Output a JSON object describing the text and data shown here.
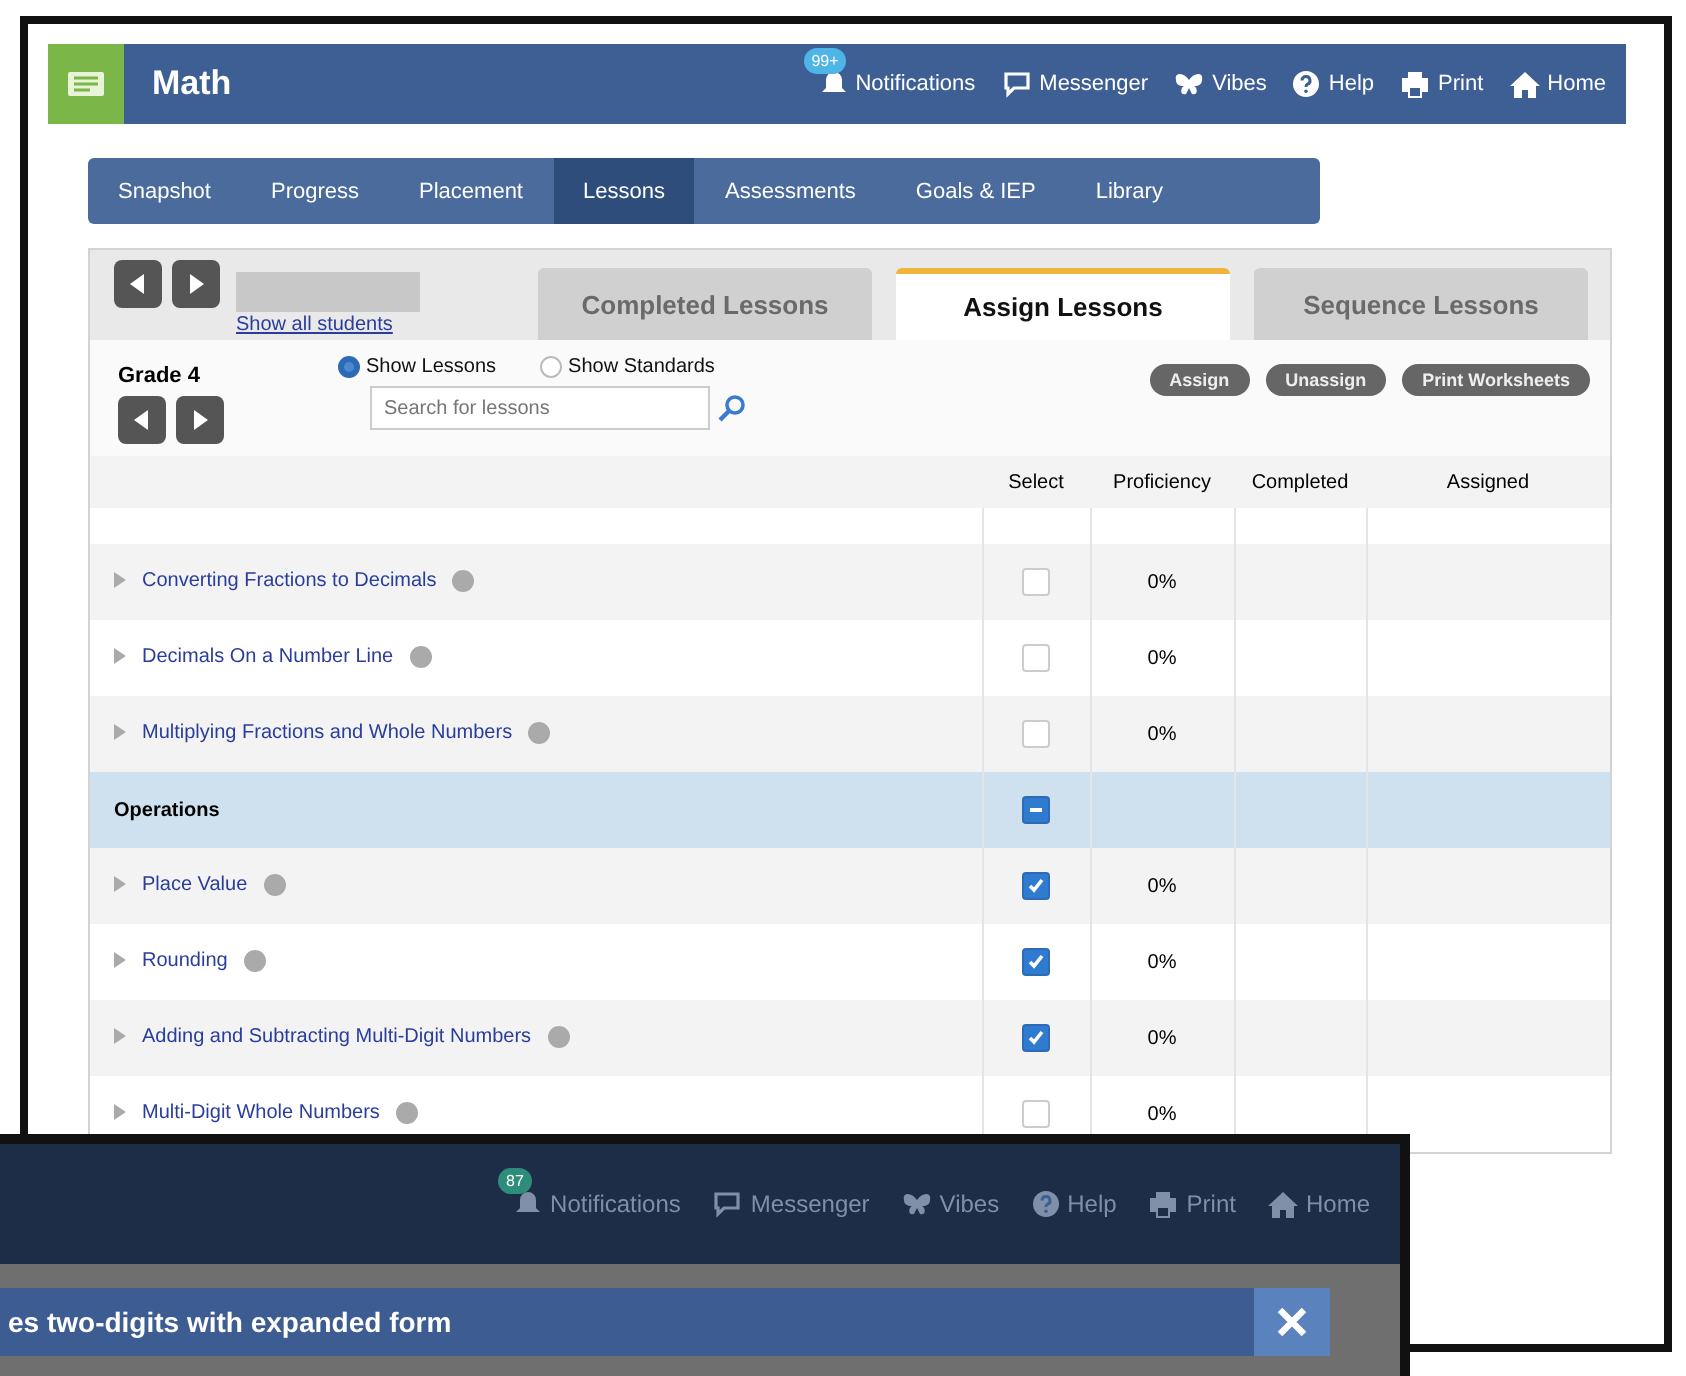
{
  "main_window": {
    "app_title": "Math",
    "header_links": [
      {
        "label": "Notifications",
        "badge": "99+"
      },
      {
        "label": "Messenger"
      },
      {
        "label": "Vibes"
      },
      {
        "label": "Help"
      },
      {
        "label": "Print"
      },
      {
        "label": "Home"
      }
    ],
    "nav_tabs": [
      {
        "label": "Snapshot",
        "selected": false
      },
      {
        "label": "Progress",
        "selected": false
      },
      {
        "label": "Placement",
        "selected": false
      },
      {
        "label": "Lessons",
        "selected": true
      },
      {
        "label": "Assessments",
        "selected": false
      },
      {
        "label": "Goals & IEP",
        "selected": false
      },
      {
        "label": "Library",
        "selected": false
      }
    ],
    "student_link": "Show all students",
    "lesson_tabs": [
      {
        "label": "Completed Lessons",
        "selected": false
      },
      {
        "label": "Assign Lessons",
        "selected": true
      },
      {
        "label": "Sequence Lessons",
        "selected": false
      }
    ],
    "grade": "Grade 4",
    "view_options": [
      {
        "label": "Show Lessons",
        "selected": true
      },
      {
        "label": "Show Standards",
        "selected": false
      }
    ],
    "search": {
      "placeholder": "Search for lessons"
    },
    "actions": [
      "Assign",
      "Unassign",
      "Print Worksheets"
    ],
    "table": {
      "columns": [
        "Select",
        "Proficiency",
        "Completed",
        "Assigned"
      ],
      "rows": [
        {
          "kind": "lesson",
          "title": "Converting Fractions to Decimals",
          "checked": false,
          "proficiency": "0%"
        },
        {
          "kind": "lesson",
          "title": "Decimals On a Number Line",
          "checked": false,
          "proficiency": "0%"
        },
        {
          "kind": "lesson",
          "title": "Multiplying Fractions and Whole Numbers",
          "checked": false,
          "proficiency": "0%"
        },
        {
          "kind": "group",
          "title": "Operations",
          "indeterminate": true
        },
        {
          "kind": "lesson",
          "title": "Place Value",
          "checked": true,
          "proficiency": "0%"
        },
        {
          "kind": "lesson",
          "title": "Rounding",
          "checked": true,
          "proficiency": "0%"
        },
        {
          "kind": "lesson",
          "title": "Adding and Subtracting Multi-Digit Numbers",
          "checked": true,
          "proficiency": "0%"
        },
        {
          "kind": "lesson",
          "title": "Multi-Digit Whole Numbers",
          "checked": false,
          "proficiency": "0%"
        }
      ]
    }
  },
  "overlay_window": {
    "header_links": [
      {
        "label": "Notifications",
        "badge": "87"
      },
      {
        "label": "Messenger"
      },
      {
        "label": "Vibes"
      },
      {
        "label": "Help"
      },
      {
        "label": "Print"
      },
      {
        "label": "Home"
      }
    ],
    "dialog_title": "es two-digits with expanded form"
  }
}
